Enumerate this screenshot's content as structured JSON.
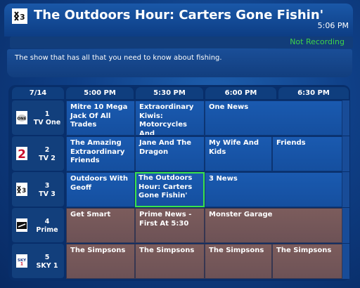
{
  "header": {
    "channel_logo": "tv3-logo-icon",
    "title": "The Outdoors Hour: Carters Gone Fishin'",
    "time": "5:06 PM",
    "recording_status": "Not Recording",
    "description": "The show that has all that you need to know about fishing."
  },
  "grid": {
    "date": "7/14",
    "times": [
      "5:00 PM",
      "5:30 PM",
      "6:00 PM",
      "6:30 PM"
    ],
    "channels": [
      {
        "number": "1",
        "name": "TV One",
        "logo": "tv-one-logo-icon"
      },
      {
        "number": "2",
        "name": "TV 2",
        "logo": "tv2-logo-icon"
      },
      {
        "number": "3",
        "name": "TV 3",
        "logo": "tv3-logo-icon"
      },
      {
        "number": "4",
        "name": "Prime",
        "logo": "prime-logo-icon"
      },
      {
        "number": "5",
        "name": "SKY 1",
        "logo": "sky1-logo-icon"
      }
    ],
    "rows": [
      {
        "programs": [
          "Mitre 10 Mega Jack Of All Trades",
          "Extraordinary Kiwis: Motorcycles And",
          "One News"
        ]
      },
      {
        "programs": [
          "The Amazing Extraordinary Friends",
          "Jane And The Dragon",
          "My Wife And Kids",
          "Friends"
        ]
      },
      {
        "programs": [
          "Outdoors With Geoff",
          "The Outdoors Hour: Carters Gone Fishin'",
          "3 News"
        ]
      },
      {
        "programs": [
          "Get Smart",
          "Prime News - First At 5:30",
          "Monster Garage"
        ]
      },
      {
        "programs": [
          "The Simpsons",
          "The Simpsons",
          "The Simpsons",
          "The Simpsons"
        ]
      }
    ]
  },
  "colors": {
    "selected_border": "#3be24b",
    "recording_status": "#3ed24a",
    "genre_blue": "#1a5ab0",
    "genre_brown": "#7c5c5c"
  }
}
